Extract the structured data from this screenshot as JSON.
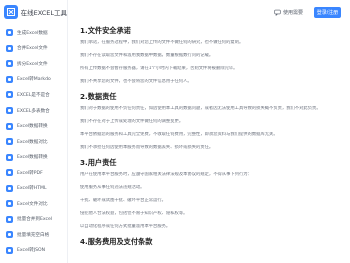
{
  "brand": {
    "name": "在线EXCEL工具"
  },
  "sidebar": {
    "items": [
      {
        "label": "生成Excel数据"
      },
      {
        "label": "合并Excel文件"
      },
      {
        "label": "拆分Excel文件"
      },
      {
        "label": "Excel转Markdo"
      },
      {
        "label": "EXCEL是不是合"
      },
      {
        "label": "EXCEL多表数合"
      },
      {
        "label": "Excel数据转换"
      },
      {
        "label": "Excel数据对比"
      },
      {
        "label": "Excel数据转换"
      },
      {
        "label": "Excel转PDF"
      },
      {
        "label": "Excel转HTML"
      },
      {
        "label": "Excel文件对比"
      },
      {
        "label": "批量合并到Excel"
      },
      {
        "label": "批量填充空白格"
      },
      {
        "label": "Excel转JSON"
      }
    ]
  },
  "topbar": {
    "feedback_label": "使用需要",
    "login_label": "登录/注册"
  },
  "sections": [
    {
      "title": "1.文件安全承诺",
      "paragraphs": [
        "我们承诺，在服务过程中，我们对您上传的文件不做任何的研究，也不做任何的复制。",
        "我们不存在读取您文件和滥用我数据中数据，数量根据数行问的记载。",
        "所有上传数据不会暂存服务器，请在1个小时内下载结果，否则文件将被删除完毕。",
        "我们不共享您的文件，也不会将您的文件信息用于任何人。"
      ]
    },
    {
      "title": "2.数据责任",
      "paragraphs": [
        "我们对于数据的使用不负任何责任，如因使用本工具的数据问题，或者因无法使用工具导致的损失概不负责，我们不对此负责。",
        "我们不存在对于上传或处理的文件做任何的调整变更。",
        "本平台依据您的服务和工具完全免费，不收取任何费用，完整性，即须您资料与我们提供的数据库无关。",
        "我们不承担任何因使用本服务而导致的数据丢失、损坏或损失的责任。"
      ]
    },
    {
      "title": "3.用户责任",
      "paragraphs": [
        "用户在使用本平台服务时，应遵守国家相关法律法规及本协议的规定，不得从事下列行为：",
        "使用服务从事任何违法违规活动。",
        "干扰、破坏或试图干扰、破坏平台正常运行。",
        "侵犯他人合法权益，包括但不限于知识产权、隐私权等。",
        "以自动化程序或任何方式批量滥用本平台服务。"
      ]
    },
    {
      "title": "4.服务费用及支付条款",
      "paragraphs": []
    }
  ]
}
